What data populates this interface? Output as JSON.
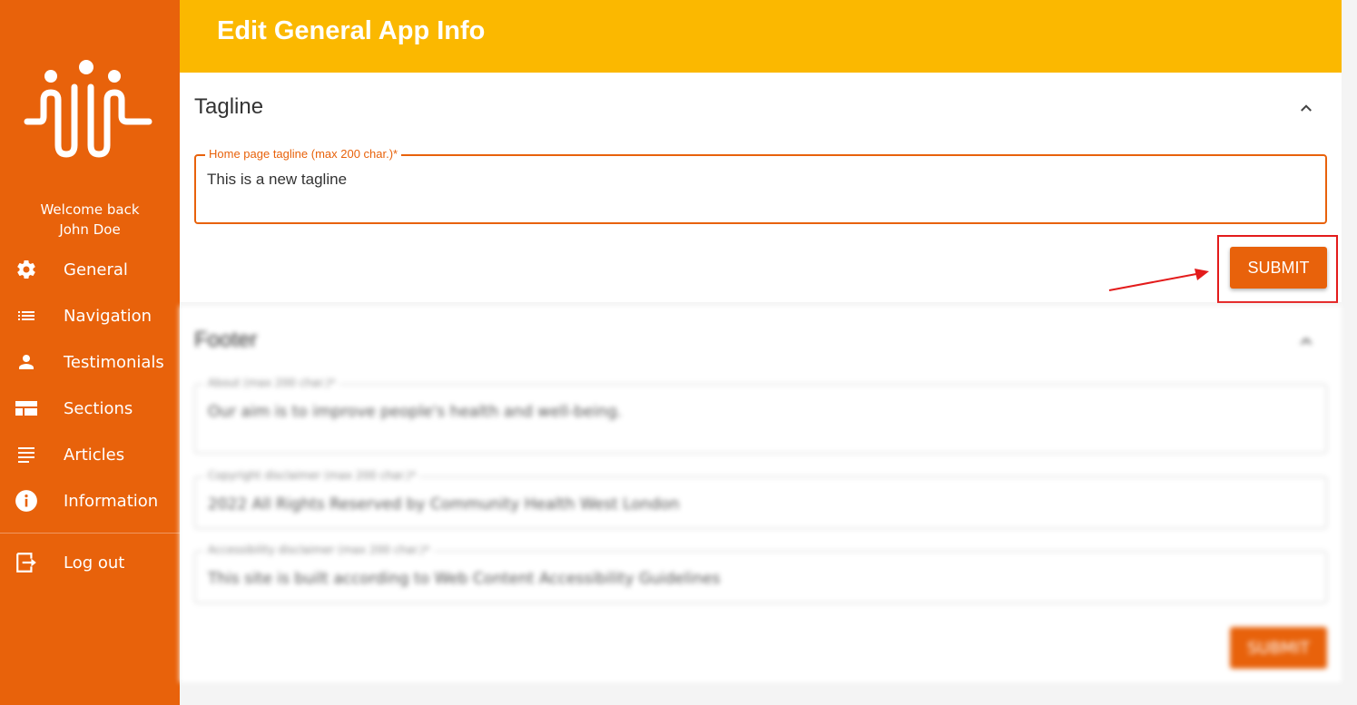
{
  "sidebar": {
    "welcome_line1": "Welcome back",
    "welcome_line2": "John Doe",
    "items": [
      {
        "label": "General",
        "icon": "gear-icon"
      },
      {
        "label": "Navigation",
        "icon": "list-icon"
      },
      {
        "label": "Testimonials",
        "icon": "person-icon"
      },
      {
        "label": "Sections",
        "icon": "sections-icon"
      },
      {
        "label": "Articles",
        "icon": "articles-icon"
      },
      {
        "label": "Information",
        "icon": "info-icon"
      }
    ],
    "logout": {
      "label": "Log out",
      "icon": "logout-icon"
    }
  },
  "header": {
    "title": "Edit General App Info"
  },
  "tagline_panel": {
    "title": "Tagline",
    "field_label": "Home page tagline (max 200 char.)*",
    "field_value": "This is a new tagline",
    "submit_label": "SUBMIT"
  },
  "footer_panel": {
    "title": "Footer",
    "fields": [
      {
        "label": "About (max 200 char.)*",
        "value": "Our aim is to improve people's health and well-being."
      },
      {
        "label": "Copyright disclaimer (max 200 char.)*",
        "value": "2022 All Rights Reserved by Community Health West London"
      },
      {
        "label": "Accessibility disclaimer (max 200 char.)*",
        "value": "This site is built according to Web Content Accessibility Guidelines"
      }
    ],
    "submit_label": "SUBMIT"
  },
  "colors": {
    "sidebar": "#e8620b",
    "header": "#fbb800",
    "accent": "#e8620b",
    "annotation": "#e31b1b"
  }
}
